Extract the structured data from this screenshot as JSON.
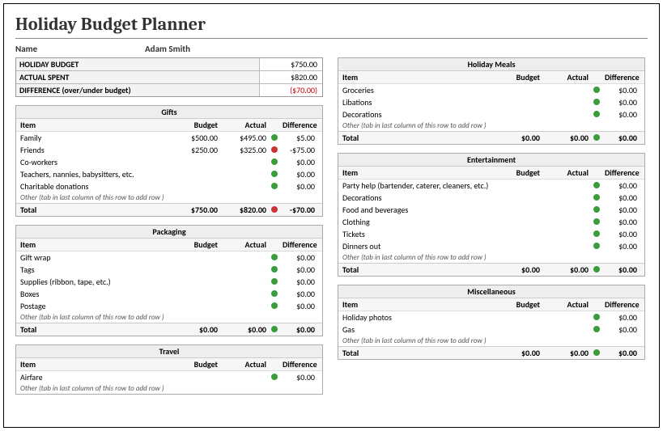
{
  "title": "Holiday Budget Planner",
  "name_label": "Name",
  "name_value": "Adam Smith",
  "labels": {
    "item": "Item",
    "budget": "Budget",
    "actual": "Actual",
    "difference": "Difference",
    "total": "Total",
    "add_row": "Other (tab in last column of this row to add row )"
  },
  "summary": {
    "budget_label": "HOLIDAY BUDGET",
    "budget_value": "$750.00",
    "spent_label": "ACTUAL SPENT",
    "spent_value": "$820.00",
    "diff_label": "DIFFERENCE (over/under budget)",
    "diff_value": "($70.00)"
  },
  "sections": {
    "gifts": {
      "title": "Gifts",
      "rows": [
        {
          "item": "Family",
          "budget": "$500.00",
          "actual": "$495.00",
          "ind": "green",
          "diff": "$5.00"
        },
        {
          "item": "Friends",
          "budget": "$250.00",
          "actual": "$325.00",
          "ind": "red",
          "diff": "-$75.00"
        },
        {
          "item": "Co-workers",
          "budget": "",
          "actual": "",
          "ind": "green",
          "diff": "$0.00"
        },
        {
          "item": "Teachers, nannies, babysitters, etc.",
          "budget": "",
          "actual": "",
          "ind": "green",
          "diff": "$0.00"
        },
        {
          "item": "Charitable donations",
          "budget": "",
          "actual": "",
          "ind": "green",
          "diff": "$0.00"
        }
      ],
      "total": {
        "budget": "$750.00",
        "actual": "$820.00",
        "ind": "red",
        "diff": "-$70.00"
      }
    },
    "packaging": {
      "title": "Packaging",
      "rows": [
        {
          "item": "Gift wrap",
          "budget": "",
          "actual": "",
          "ind": "green",
          "diff": "$0.00"
        },
        {
          "item": "Tags",
          "budget": "",
          "actual": "",
          "ind": "green",
          "diff": "$0.00"
        },
        {
          "item": "Supplies (ribbon, tape, etc.)",
          "budget": "",
          "actual": "",
          "ind": "green",
          "diff": "$0.00"
        },
        {
          "item": "Boxes",
          "budget": "",
          "actual": "",
          "ind": "green",
          "diff": "$0.00"
        },
        {
          "item": "Postage",
          "budget": "",
          "actual": "",
          "ind": "green",
          "diff": "$0.00"
        }
      ],
      "total": {
        "budget": "$0.00",
        "actual": "$0.00",
        "ind": "green",
        "diff": "$0.00"
      }
    },
    "travel": {
      "title": "Travel",
      "rows": [
        {
          "item": "Airfare",
          "budget": "",
          "actual": "",
          "ind": "green",
          "diff": "$0.00"
        }
      ],
      "total": null
    },
    "meals": {
      "title": "Holiday Meals",
      "rows": [
        {
          "item": "Groceries",
          "budget": "",
          "actual": "",
          "ind": "green",
          "diff": "$0.00"
        },
        {
          "item": "Libations",
          "budget": "",
          "actual": "",
          "ind": "green",
          "diff": "$0.00"
        },
        {
          "item": "Decorations",
          "budget": "",
          "actual": "",
          "ind": "green",
          "diff": "$0.00"
        }
      ],
      "total": {
        "budget": "$0.00",
        "actual": "$0.00",
        "ind": "green",
        "diff": "$0.00"
      }
    },
    "entertainment": {
      "title": "Entertainment",
      "rows": [
        {
          "item": "Party help (bartender, caterer, cleaners, etc.)",
          "budget": "",
          "actual": "",
          "ind": "green",
          "diff": "$0.00"
        },
        {
          "item": "Decorations",
          "budget": "",
          "actual": "",
          "ind": "green",
          "diff": "$0.00"
        },
        {
          "item": "Food and beverages",
          "budget": "",
          "actual": "",
          "ind": "green",
          "diff": "$0.00"
        },
        {
          "item": "Clothing",
          "budget": "",
          "actual": "",
          "ind": "green",
          "diff": "$0.00"
        },
        {
          "item": "Tickets",
          "budget": "",
          "actual": "",
          "ind": "green",
          "diff": "$0.00"
        },
        {
          "item": "Dinners out",
          "budget": "",
          "actual": "",
          "ind": "green",
          "diff": "$0.00"
        }
      ],
      "total": {
        "budget": "$0.00",
        "actual": "$0.00",
        "ind": "green",
        "diff": "$0.00"
      }
    },
    "misc": {
      "title": "Miscellaneous",
      "rows": [
        {
          "item": "Holiday photos",
          "budget": "",
          "actual": "",
          "ind": "green",
          "diff": "$0.00"
        },
        {
          "item": "Gas",
          "budget": "",
          "actual": "",
          "ind": "green",
          "diff": "$0.00"
        }
      ],
      "total": {
        "budget": "$0.00",
        "actual": "$0.00",
        "ind": "green",
        "diff": "$0.00"
      }
    }
  }
}
